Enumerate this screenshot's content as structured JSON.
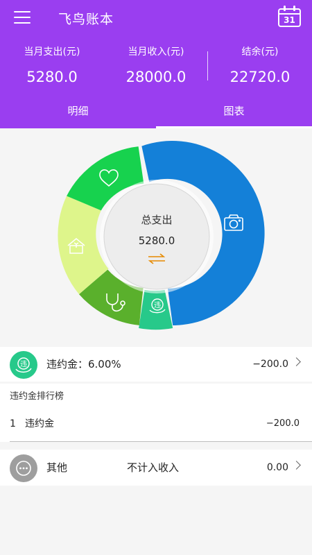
{
  "header": {
    "title": "飞鸟账本",
    "calendar_day": "31",
    "stats": [
      {
        "label": "当月支出(元)",
        "value": "5280.0"
      },
      {
        "label": "当月收入(元)",
        "value": "28000.0"
      },
      {
        "label": "结余(元)",
        "value": "22720.0"
      }
    ]
  },
  "tabs": [
    {
      "label": "明细",
      "active": false
    },
    {
      "label": "图表",
      "active": true
    }
  ],
  "donut": {
    "center_label": "总支出",
    "center_value": "5280.0",
    "segments": [
      {
        "category": "camera",
        "icon": "camera-icon",
        "color": "#1480d8"
      },
      {
        "category": "penalty",
        "icon": "penalty-icon",
        "color": "#27c98a"
      },
      {
        "category": "medical",
        "icon": "stethoscope-icon",
        "color": "#5ab02c"
      },
      {
        "category": "housing",
        "icon": "house-icon",
        "color": "#def58b"
      },
      {
        "category": "health",
        "icon": "heart-icon",
        "color": "#17d24e"
      }
    ]
  },
  "selected_category": {
    "label": "违约金：6.00%",
    "amount": "−200.0",
    "icon": "penalty-icon",
    "icon_text": "违",
    "color": "#27c98a"
  },
  "ranking": {
    "title": "违约金排行榜",
    "items": [
      {
        "index": "1",
        "name": "违约金",
        "amount": "−200.0"
      }
    ]
  },
  "other_row": {
    "label": "其他",
    "note": "不计入收入",
    "amount": "0.00",
    "icon": "more-icon"
  }
}
